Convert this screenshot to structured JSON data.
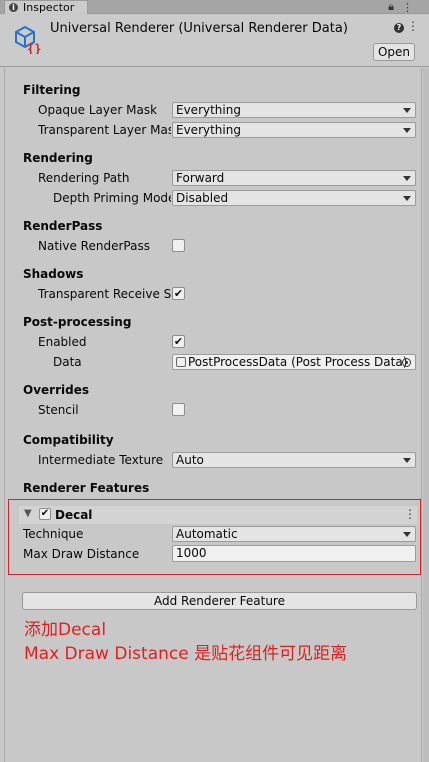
{
  "tab": {
    "label": "Inspector"
  },
  "header": {
    "title": "Universal Renderer (Universal Renderer Data)",
    "open_label": "Open"
  },
  "sections": {
    "filtering": "Filtering",
    "rendering": "Rendering",
    "renderpass": "RenderPass",
    "shadows": "Shadows",
    "postprocessing": "Post-processing",
    "overrides": "Overrides",
    "compatibility": "Compatibility",
    "renderer_features": "Renderer Features"
  },
  "fields": {
    "opaque_layer_mask": {
      "label": "Opaque Layer Mask",
      "value": "Everything"
    },
    "transparent_layer_mask": {
      "label": "Transparent Layer Mask",
      "value": "Everything"
    },
    "rendering_path": {
      "label": "Rendering Path",
      "value": "Forward"
    },
    "depth_priming_mode": {
      "label": "Depth Priming Mode",
      "value": "Disabled"
    },
    "native_renderpass": {
      "label": "Native RenderPass",
      "checked": false
    },
    "transparent_receive_shadows": {
      "label": "Transparent Receive Shadows",
      "checked": true
    },
    "pp_enabled": {
      "label": "Enabled",
      "checked": true
    },
    "pp_data": {
      "label": "Data",
      "value": "PostProcessData (Post Process Data)"
    },
    "stencil": {
      "label": "Stencil",
      "checked": false
    },
    "intermediate_texture": {
      "label": "Intermediate Texture",
      "value": "Auto"
    }
  },
  "decal": {
    "name": "Decal",
    "enabled": true,
    "technique": {
      "label": "Technique",
      "value": "Automatic"
    },
    "max_draw_distance": {
      "label": "Max Draw Distance",
      "value": "1000"
    }
  },
  "add_feature_label": "Add Renderer Feature",
  "annotations": {
    "line1": "添加Decal",
    "line2": "Max Draw Distance 是贴花组件可见距离"
  },
  "colors": {
    "annotation_red": "#e81c1c",
    "background": "#c8c8c8"
  }
}
